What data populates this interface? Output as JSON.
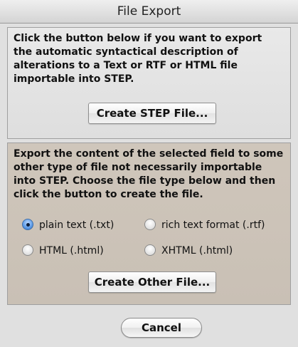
{
  "window": {
    "title": "File Export"
  },
  "step_section": {
    "description": "Click the button below if you want to export the automatic syntactical description of alterations to a Text or RTF or HTML file importable into STEP.",
    "button_label": "Create STEP File..."
  },
  "other_section": {
    "description": "Export the content of the selected field to some other type of file not necessarily importable into STEP. Choose the file type below and then click the button to create the file.",
    "options": [
      {
        "label": "plain text (.txt)",
        "selected": true
      },
      {
        "label": "rich text format (.rtf)",
        "selected": false
      },
      {
        "label": "HTML (.html)",
        "selected": false
      },
      {
        "label": "XHTML (.html)",
        "selected": false
      }
    ],
    "button_label": "Create Other File..."
  },
  "footer": {
    "cancel_label": "Cancel"
  },
  "colors": {
    "selected_radio": "#5d9be6",
    "lower_panel_bg": "#cfc6bb"
  }
}
